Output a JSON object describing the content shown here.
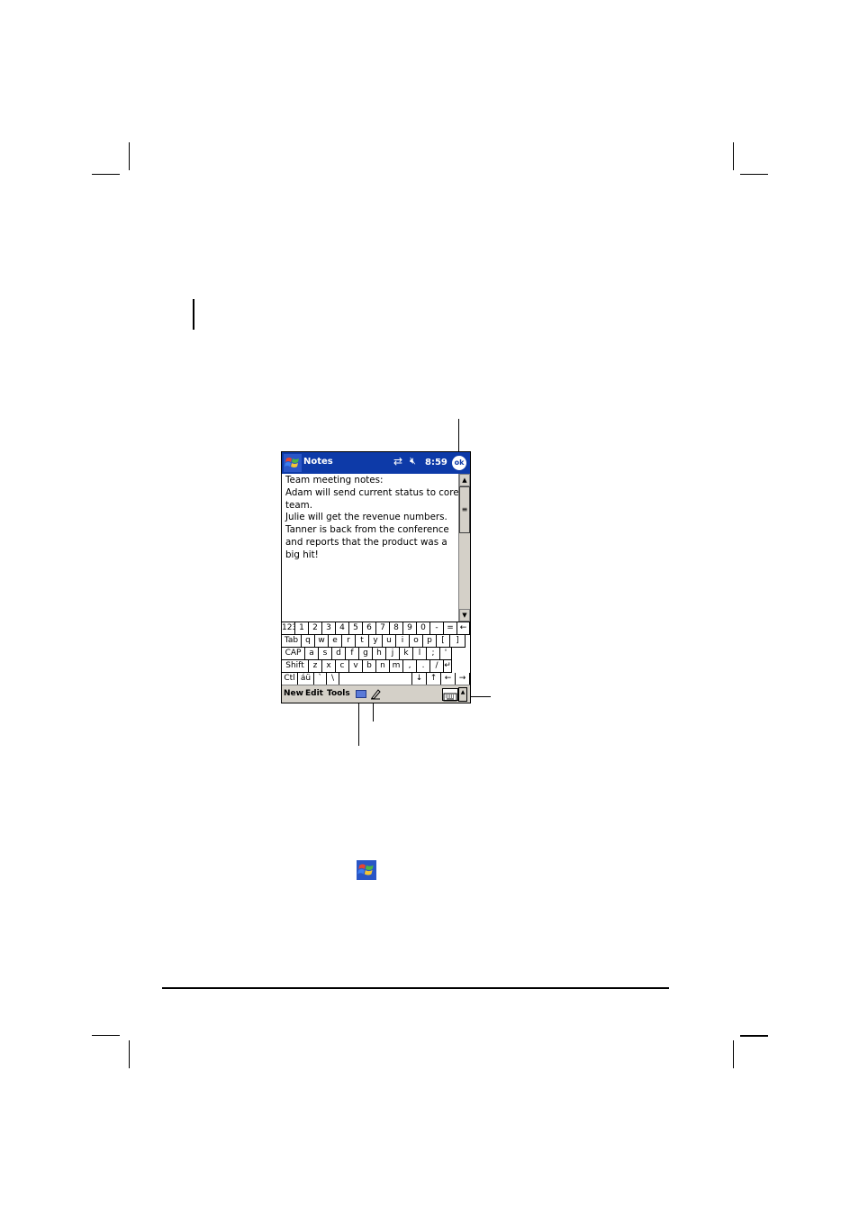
{
  "window": {
    "title": "Notes",
    "time": "8:59",
    "ok_label": "ok",
    "connectivity_icon": "connectivity-icon",
    "volume_icon": "speaker-muted-icon"
  },
  "note": {
    "lines": [
      "Team meeting notes:",
      "",
      "Adam will send current status to core",
      "team.",
      "",
      "Julie will get the revenue numbers.",
      "",
      "Tanner is back from the conference",
      "and reports that the product was a",
      "big hit!"
    ]
  },
  "keyboard": {
    "rows": [
      [
        "123",
        "1",
        "2",
        "3",
        "4",
        "5",
        "6",
        "7",
        "8",
        "9",
        "0",
        "-",
        "=",
        "←"
      ],
      [
        "Tab",
        "q",
        "w",
        "e",
        "r",
        "t",
        "y",
        "u",
        "i",
        "o",
        "p",
        "[",
        "]"
      ],
      [
        "CAP",
        "a",
        "s",
        "d",
        "f",
        "g",
        "h",
        "j",
        "k",
        "l",
        ";",
        "'"
      ],
      [
        "Shift",
        "z",
        "x",
        "c",
        "v",
        "b",
        "n",
        "m",
        ",",
        ".",
        "/",
        "↵"
      ],
      [
        "Ctl",
        "áü",
        "`",
        "\\",
        "",
        "↓",
        "↑",
        "←",
        "→"
      ]
    ]
  },
  "menu": {
    "new": "New",
    "edit": "Edit",
    "tools": "Tools",
    "input_icon": "input-method-icon",
    "pen_icon": "pen-icon",
    "keyboard_icon": "keyboard-icon",
    "input_arrow_icon": "input-selector-arrow-icon"
  },
  "colors": {
    "titlebar": "#0d3aa8",
    "menubar": "#d4d0c8"
  }
}
